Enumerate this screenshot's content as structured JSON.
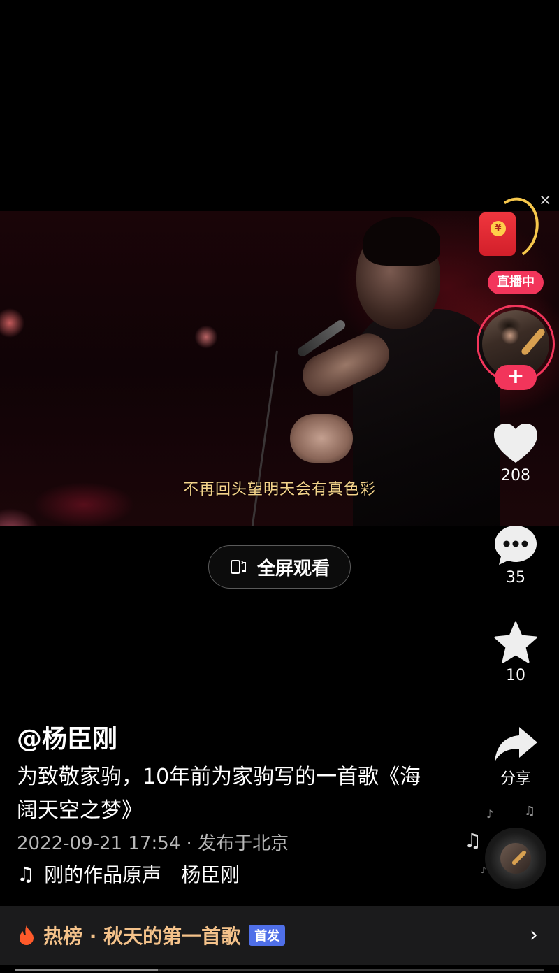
{
  "video": {
    "subtitle": "不再回头望明天会有真色彩"
  },
  "fullscreen": {
    "label": "全屏观看",
    "icon": "fullscreen-rotate-icon"
  },
  "sidebar": {
    "close_symbol": "×",
    "red_packet_symbol": "¥",
    "live_badge": "直播中",
    "follow_symbol": "+",
    "like": {
      "icon": "heart-icon",
      "count": "208"
    },
    "comment": {
      "icon": "comment-icon",
      "count": "35"
    },
    "favorite": {
      "icon": "star-icon",
      "count": "10"
    },
    "share": {
      "icon": "share-icon",
      "label": "分享"
    }
  },
  "post": {
    "author": "@杨臣刚",
    "description": "为致敬家驹，10年前为家驹写的一首歌《海阔天空之梦》",
    "meta": "2022-09-21 17:54 · 发布于北京",
    "music": "刚的作品原声　杨臣刚"
  },
  "hotbar": {
    "text": "热榜 · 秋天的第一首歌",
    "badge": "首发",
    "badge_color": "#4f6fe8",
    "chevron": "›"
  },
  "playback": {
    "progress": 0.27
  },
  "colors": {
    "accent": "#f2355b",
    "hot_text": "#f4c28a"
  }
}
